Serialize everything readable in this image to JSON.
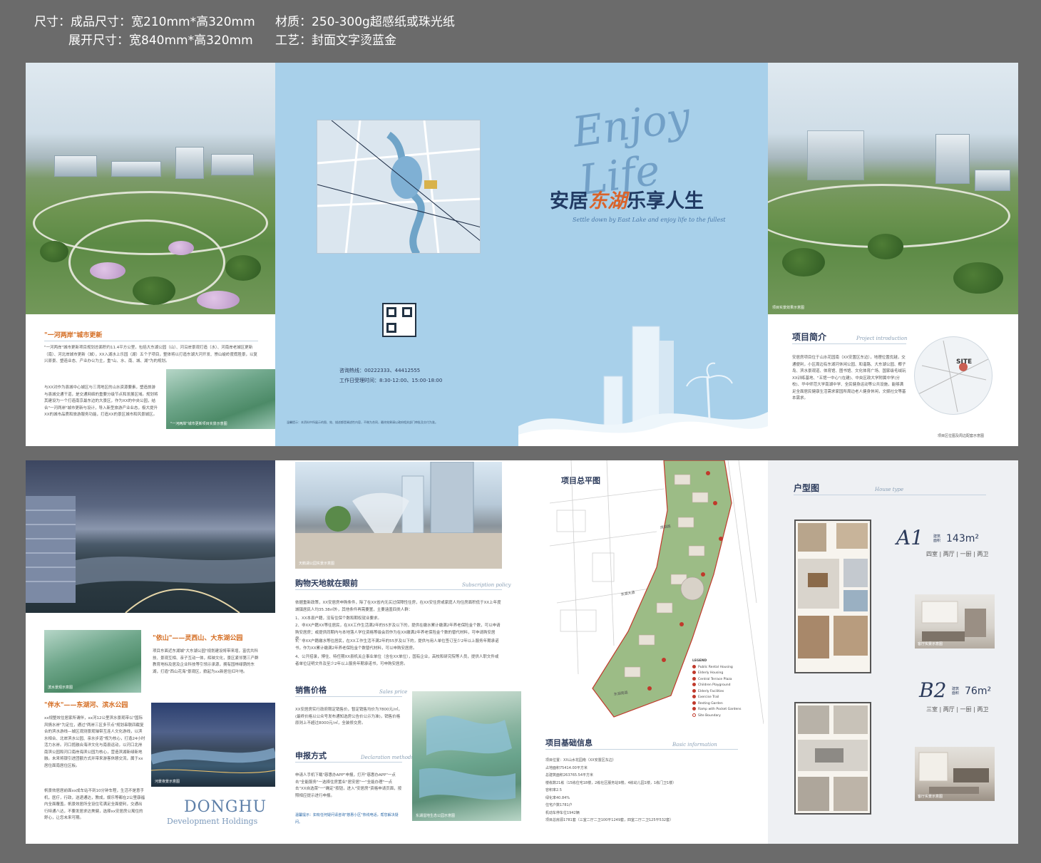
{
  "spec": {
    "size_label": "尺寸：",
    "finished": "成品尺寸：宽210mm*高320mm",
    "unfolded": "展开尺寸：宽840mm*高320mm",
    "material": "材质：250-300g超感纸或珠光纸",
    "process": "工艺：封面文字烫蓝金"
  },
  "top": {
    "p1": {
      "title": "\"一河两岸\"城市更新",
      "body1": "\"一河两岸\"城市更新项目规划总面积约11.4平方公里，包括大东湖公园（山）、河沿岸景观打造（水）、河南岸老城区更新（南）、河北岸城市更新（城），XX入湖水上乐园（湖）五个子项目，整体将以打造东湖大河开发、崇山峻岭度假胜景，以复兴原景、塑造业态、产业办公为主，重\"山、水、南、城、湖\"为的规划。",
      "body2": "与XX对作为县城中心城区与三湾地区的山水资源要素，塑造旅游与县城交通干道，是交通网络的重要分级节点和发展区域。规划将其建设为一个打造南京最东边的大景区，作为XX的中央公园，结合\"一河两岸\"城市更新与设计，导入新型旅游产业业态，极大提升XX的城市品质和旅游服务功能，打造XX的景区城市和风景城区。",
      "img_caption": "\"一河两岸\"城市更新项目实景示意图"
    },
    "p2": {
      "phone": "咨询热线：00222333、44412555",
      "hours": "工作日受理时间：8:30-12:00、15:00-18:00",
      "disclaimer": "温馨提示：本资料中所展示的图、效、描述都是阐述性内容，不做为合同，最终效果请以政府相关部门审批及交付为准。"
    },
    "p3": {
      "script": "Enjoy Life",
      "slogan_a": "安居",
      "slogan_hl": "东湖",
      "slogan_b": "乐享人生",
      "subtitle": "Settle down by East Lake and enjoy life to the fullest"
    },
    "p4": {
      "img_caption": "项目实景效果示意图",
      "title": "项目简介",
      "sub": "Project introduction",
      "body": "安居房项目位于山水花园南（XX安置区东边），地理位置优越，交通便利，小区周边有东湖河休闲公园、和谐路、大东湖公园、椰子岛、滨水景观道、体育馆、图书馆、文化体育广场、国家级毛绒玩XX训练基地、\"五馆一中心\"(在建)、中央区政大学附属中学(分校)、华中师范大学南湖中学、全民健身运动等公共设施，能够满足全面居民健康生活需求家园所周边老人健身休闲，文娱社交等基本需求。",
      "map_site": "SITE",
      "map_caption": "项目区位图及周边配套示意图"
    }
  },
  "bottom": {
    "p1": {
      "title_a": "\"依山\"——灵西山、大东湖公园",
      "body_a": "项目东面近东湖城\"大东湖公园\"规划建设将带来增，富优共科技、景观互相、亲子互动一体，辉映文化，景区紧邻第三产群教育地标及居及企业科技等引领示承源，拥有园林绿荫的东湖，打造\"西山花海\"景观区，掀起为xx新居住红叶地。",
      "title_b": "\"伴水\"——东湖河、滨水公园",
      "body_b": "xx规整效住居家所谓伴，xx河12公里滨水景观带以\"国际风情水岸\"为定位，通过\"两岸三区多节点\"规划串联四截复合的滨水游线—城区观测景观轴带互连人文化游线，以滨水相合、北岸滨水公园、亲水步道\"规为核心，打造24小时活力水岸。河口揽融合海洋文化与南县运动，以河口北岸南滨公园和河口南岸海滨公园为核心，营造滨湖新绿新地融。未来将银引进团额方式并带来游客休憩交流，属于xx居住面南居住区板。",
      "body_c": "帆景效居居前面xx成车站不到10分钟车程，生活不是意手机，医疗，行政，送递通达，教成，娱乐等都在2公里康福内全面覆盖。帆景效居所全设住宅满足全面便利，交通出行特通八达，不要发居求达美健，选择xx安居房公寓住的舒心，让您未来可期。",
      "img1_caption": "滨水景观示意图",
      "img2_caption": "河景夜景示意图",
      "brand_a": "DONGHU",
      "brand_b": "Development Holdings"
    },
    "p2": {
      "img_caption": "天鹅湖公园实景示意图",
      "title1": "购物天地就在眼前",
      "sub1": "Subscription policy",
      "body1a": "依据重新政策，XX安居房申购条件，除了在XX省内无买过保障性住房，在XX安住房或家庭人均住房面积低于XX上年度城镇居民人均35.38㎡外，其他条件再需要置，主要涵盖四类人群：",
      "body1b": "1、XX本县户籍，没有住保个数和期权就业要求。",
      "body1c": "2、非XX户籍XX等往居民，在XX工作生活满2年的55岁及以下的，提供在缴水累计缴满2年养老保险金个数，可以申请购安居房；或提供同期内与本地落人学位资格等级会同作为在XX缴满2年养老保险金个数的替代材料，可申请购安居房。",
      "body1d": "3、非XX户籍缴水等往居民，在XX工作生活不满2年的55岁及以下的，提供与用人单位签订至少2年以上服务年期承诺书，作为XX累计缴满2年养老保险金个数替代材料，可以申购安居房。",
      "body1e": "4、公开招录，博住、特任期XX县机关企事业单位（含在XX单位），国有企业，高校和研究院等人员，提供人职文件或者单位证明文件及至少2年以上服务年期承诺书，可申购安居房。",
      "title2": "销售价格",
      "sub2": "Sales price",
      "body2": "XX安居房实行政府限定销售价，暂定销售均价为7800元/㎡，(最终价格以公众号发布通知选房公告价公示为准)，销售价格原则上不超过8000元/㎡，全装修交房。",
      "title3": "申报方式",
      "sub3": "Declaration methods",
      "body3": "申请人手机下载\"慈惠办APP\"申报，打开\"慈惠办APP\"一点击\"全能服务\"一选择住房置业\"居安居\"一\"全能办理\"一点击\"XX自选菜\"一\"确定\"按钮，进入\"安居房\"资格申请页面，按照相应提示进行申报。",
      "body3b": "温馨提示：如有任何疑问请咨询\"慈惠小区\"热线电话，帮您解决疑问。",
      "img2_caption": "东湖湿地生态公园示意图"
    },
    "p3": {
      "title1": "项目总平图",
      "title2": "项目基础信息",
      "sub2": "Basic information",
      "legend_title": "LEGEND",
      "legend": [
        "Public Rental Housing",
        "Elderly Housing",
        "Central Terrace Plaza",
        "Children Playground",
        "Elderly Facilities",
        "Exercise Trail",
        "Resting Garden",
        "Ramp with Pocket Gardens",
        "Site Boundary"
      ],
      "info": [
        "项目位置：XX山水花园南（XX安置区东边）",
        "占地面积75414.00平方米",
        "总建筑面积263765.54平方米",
        "楼栋数21栋（15栋住宅18楼，2栋社区服务站9楼，4栋幼儿园1楼，1栋门卫1楼）",
        "容积率2.5",
        "绿化率40.84%",
        "住宅户数1781户",
        "机动车停车位1942辆",
        "项目总房源1781套（三室二厅二卫100平1249套，四室二厅二卫125平532套）"
      ],
      "road_labels": [
        "滨湖路",
        "东湖大道",
        "东湖南路"
      ]
    },
    "p4": {
      "title": "户型图",
      "sub": "House type",
      "a_code": "A1",
      "a_area_label": "建筑面积",
      "a_area": "143m²",
      "a_rooms": "四室 | 两厅 | 一厨 | 两卫",
      "b_code": "B2",
      "b_area_label": "建筑面积",
      "b_area": "76m²",
      "b_rooms": "三室 | 两厅 | 一厨 | 两卫",
      "img1_caption": "客厅实景示意图",
      "img2_caption": "客厅实景示意图"
    }
  },
  "colors": {
    "cover_blue": "#a8d0ea",
    "title_navy": "#2b3a5a",
    "accent_orange": "#d46b1f",
    "accent_blue": "#2d6aa8"
  }
}
